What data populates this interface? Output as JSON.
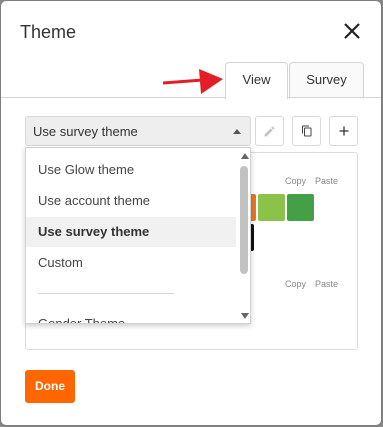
{
  "dialog": {
    "title": "Theme"
  },
  "tabs": [
    {
      "label": "View"
    },
    {
      "label": "Survey"
    }
  ],
  "theme_select": {
    "value": "Use survey theme"
  },
  "dropdown": {
    "options": [
      {
        "label": "Use Glow theme"
      },
      {
        "label": "Use account theme"
      },
      {
        "label": "Use survey theme"
      },
      {
        "label": "Custom"
      },
      {
        "label": "Gender Theme"
      }
    ],
    "selected_index": 2
  },
  "panel": {
    "copy_label": "Copy",
    "paste_label": "Paste"
  },
  "swatches": [
    {
      "color": "#e8761f"
    },
    {
      "color": "#8bc34a"
    },
    {
      "color": "#43a047"
    }
  ],
  "footer": {
    "done_label": "Done"
  },
  "colors": {
    "accent": "#ff6600",
    "arrow": "#e31e24"
  },
  "icons": [
    "close-icon",
    "pencil-icon",
    "copy-icon",
    "plus-icon",
    "red-arrow-icon"
  ]
}
